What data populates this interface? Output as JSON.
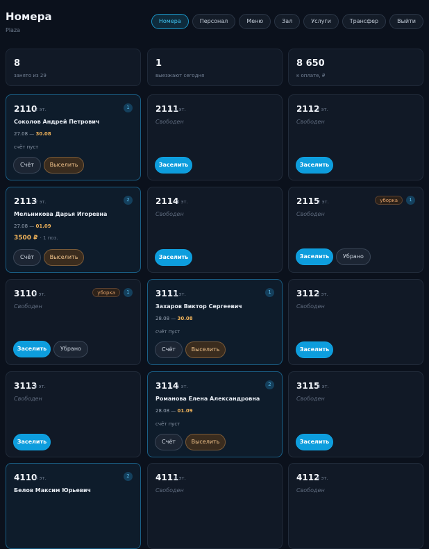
{
  "header": {
    "title": "Номера",
    "subtitle": "Plaza",
    "nav": [
      {
        "label": "Номера",
        "active": true
      },
      {
        "label": "Персонал",
        "active": false
      },
      {
        "label": "Меню",
        "active": false
      },
      {
        "label": "Зал",
        "active": false
      },
      {
        "label": "Услуги",
        "active": false
      },
      {
        "label": "Трансфер",
        "active": false
      },
      {
        "label": "Выйти",
        "active": false
      }
    ]
  },
  "stats": [
    {
      "value": "8",
      "label": "занято из 29"
    },
    {
      "value": "1",
      "label": "выезжают сегодня"
    },
    {
      "value": "8 650",
      "label": "к оплате, ₽"
    }
  ],
  "labels": {
    "free": "Свободен",
    "bill": "Счёт",
    "evict": "Выселить",
    "settle": "Заселить",
    "cleaned": "Убрано",
    "bill_empty": "счёт пуст",
    "cleaning": "уборка"
  },
  "rooms": [
    {
      "number": "2110",
      "floor": "2 эт.",
      "guest": "Соколов Андрей Петрович",
      "date_from": "27.08",
      "date_to": "30.08",
      "badge": "1",
      "bill": ""
    },
    {
      "number": "2111",
      "floor": "2 эт."
    },
    {
      "number": "2112",
      "floor": "2 эт."
    },
    {
      "number": "2113",
      "floor": "2 эт.",
      "guest": "Мельникова Дарья Игоревна",
      "date_from": "27.08",
      "date_to": "01.09",
      "badge": "2",
      "bill": "3500 ₽",
      "bill_note": "· 1 поз."
    },
    {
      "number": "2114",
      "floor": "2 эт."
    },
    {
      "number": "2115",
      "floor": "2 эт.",
      "cleaning": true,
      "badge": "1"
    },
    {
      "number": "3110",
      "floor": "3 эт.",
      "cleaning": true,
      "badge": "1"
    },
    {
      "number": "3111",
      "floor": "3 эт.",
      "guest": "Захаров Виктор Сергеевич",
      "date_from": "28.08",
      "date_to": "30.08",
      "badge": "1",
      "bill": ""
    },
    {
      "number": "3112",
      "floor": "3 эт."
    },
    {
      "number": "3113",
      "floor": "3 эт."
    },
    {
      "number": "3114",
      "floor": "3 эт.",
      "guest": "Романова Елена Александровна",
      "date_from": "28.08",
      "date_to": "01.09",
      "badge": "2",
      "bill": ""
    },
    {
      "number": "3115",
      "floor": "3 эт."
    },
    {
      "number": "4110",
      "floor": "4 эт.",
      "guest": "Белов Максим Юрьевич",
      "badge": "2"
    },
    {
      "number": "4111",
      "floor": "4 эт."
    },
    {
      "number": "4112",
      "floor": "4 эт."
    }
  ]
}
